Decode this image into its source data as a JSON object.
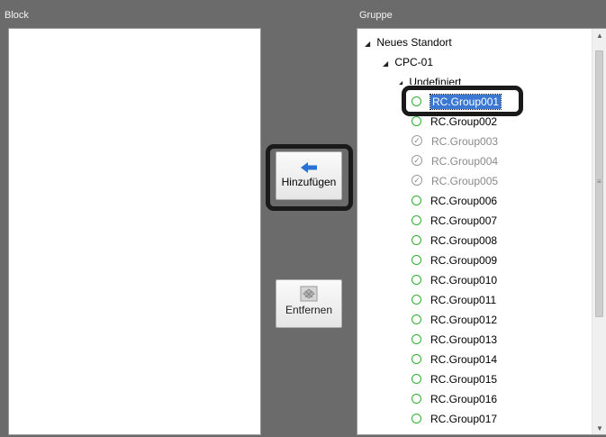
{
  "headers": {
    "block": "Block",
    "gruppe": "Gruppe"
  },
  "buttons": {
    "add": "Hinzufügen",
    "remove": "Entfernen"
  },
  "tree": {
    "root": "Neues Standort",
    "site": "CPC-01",
    "folder": "Undefiniert",
    "items": [
      {
        "label": "RC.Group001",
        "state": "selected"
      },
      {
        "label": "RC.Group002",
        "state": "available"
      },
      {
        "label": "RC.Group003",
        "state": "assigned"
      },
      {
        "label": "RC.Group004",
        "state": "assigned"
      },
      {
        "label": "RC.Group005",
        "state": "assigned"
      },
      {
        "label": "RC.Group006",
        "state": "available"
      },
      {
        "label": "RC.Group007",
        "state": "available"
      },
      {
        "label": "RC.Group008",
        "state": "available"
      },
      {
        "label": "RC.Group009",
        "state": "available"
      },
      {
        "label": "RC.Group010",
        "state": "available"
      },
      {
        "label": "RC.Group011",
        "state": "available"
      },
      {
        "label": "RC.Group012",
        "state": "available"
      },
      {
        "label": "RC.Group013",
        "state": "available"
      },
      {
        "label": "RC.Group014",
        "state": "available"
      },
      {
        "label": "RC.Group015",
        "state": "available"
      },
      {
        "label": "RC.Group016",
        "state": "available"
      },
      {
        "label": "RC.Group017",
        "state": "available"
      }
    ]
  },
  "colors": {
    "accent": "#3a78d4",
    "available": "#2fae2f",
    "assigned": "#8a8a8a",
    "arrow": "#2a72d6"
  },
  "icons": {
    "add": "arrow-left-icon",
    "remove": "remove-block-icon",
    "available": "circle-icon",
    "assigned": "checkmark-icon"
  }
}
